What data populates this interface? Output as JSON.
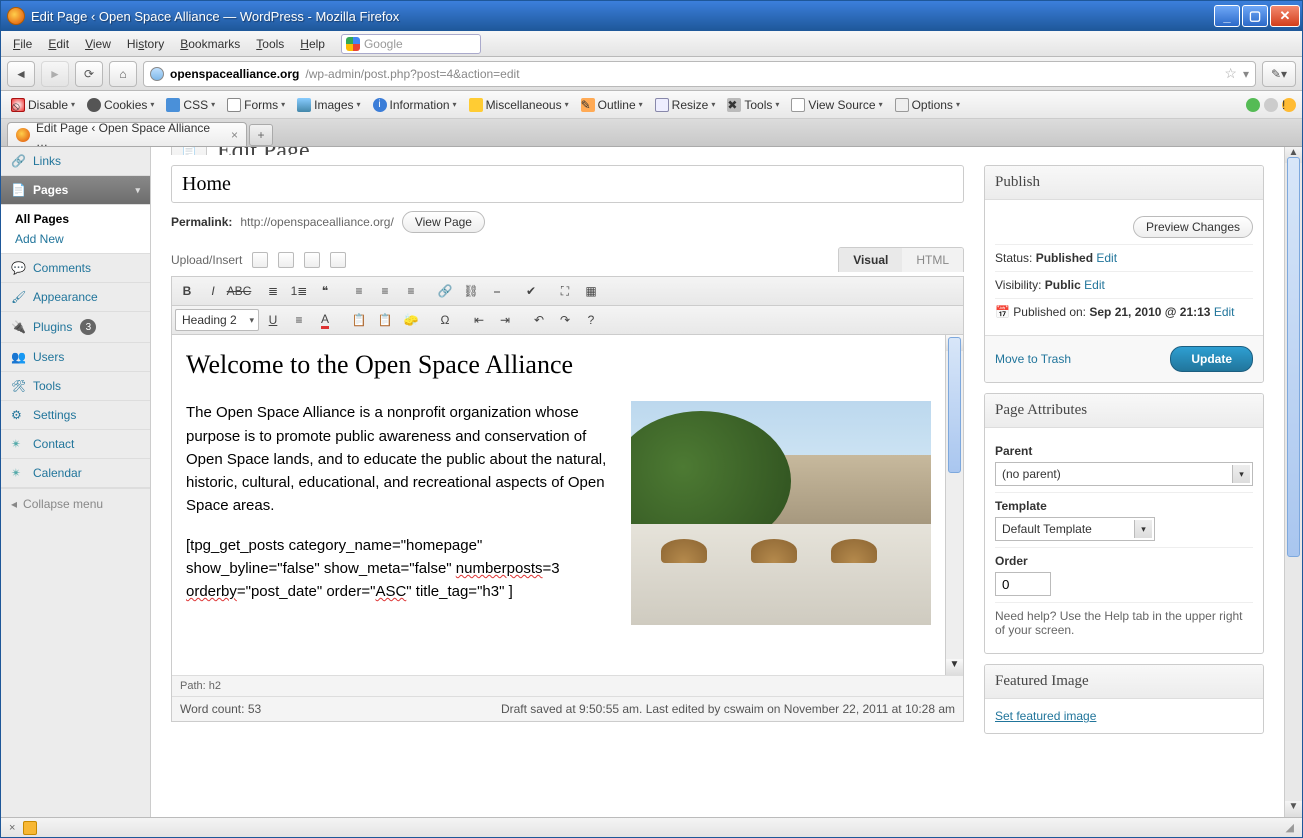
{
  "window": {
    "title": "Edit Page ‹ Open Space Alliance — WordPress - Mozilla Firefox"
  },
  "menu": {
    "file": "File",
    "edit": "Edit",
    "view": "View",
    "history": "History",
    "bookmarks": "Bookmarks",
    "tools": "Tools",
    "help": "Help",
    "search_placeholder": "Google"
  },
  "url": {
    "host": "openspacealliance.org",
    "path": "/wp-admin/post.php?post=4&action=edit"
  },
  "wdt": {
    "disable": "Disable",
    "cookies": "Cookies",
    "css": "CSS",
    "forms": "Forms",
    "images": "Images",
    "information": "Information",
    "miscellaneous": "Miscellaneous",
    "outline": "Outline",
    "resize": "Resize",
    "tools": "Tools",
    "viewsource": "View Source",
    "options": "Options"
  },
  "tab": {
    "title": "Edit Page ‹ Open Space Alliance …"
  },
  "sidebar": {
    "links": "Links",
    "pages": "Pages",
    "pages_sub_all": "All Pages",
    "pages_sub_add": "Add New",
    "comments": "Comments",
    "appearance": "Appearance",
    "plugins": "Plugins",
    "plugins_badge": "3",
    "users": "Users",
    "tools": "Tools",
    "settings": "Settings",
    "contact": "Contact",
    "calendar": "Calendar",
    "collapse": "Collapse menu"
  },
  "editpage": {
    "heading": "Edit Page"
  },
  "post": {
    "title": "Home",
    "permalink_label": "Permalink:",
    "permalink_url": "http://openspacealliance.org/",
    "view_page": "View Page",
    "upload_insert": "Upload/Insert",
    "tab_visual": "Visual",
    "tab_html": "HTML",
    "format_select": "Heading 2",
    "content_heading": "Welcome to the Open Space Alliance",
    "content_p1": "The Open Space Alliance is a nonprofit organization whose purpose is to promote public awareness and conservation of Open Space lands, and to educate the public about the natural, historic, cultural, educational, and recreational aspects of Open Space areas.",
    "shortcode_line1": "[tpg_get_posts category_name=\"homepage\" show_byline=\"false\" show_meta=\"false\" ",
    "sc_numberposts": "numberposts",
    "sc_eq3": "=3 ",
    "sc_orderby": "orderby",
    "sc_eqpd": "=\"post_date\" order=\"",
    "sc_asc": "ASC",
    "sc_tail": "\"  title_tag=\"h3\" ]",
    "path": "Path: h2",
    "wordcount_label": "Word count: ",
    "wordcount": "53",
    "autosave": "Draft saved at 9:50:55 am. Last edited by cswaim on November 22, 2011 at 10:28 am"
  },
  "publish": {
    "title": "Publish",
    "preview": "Preview Changes",
    "status_label": "Status: ",
    "status_value": "Published",
    "visibility_label": "Visibility: ",
    "visibility_value": "Public",
    "publishedon_label": "Published on: ",
    "publishedon_value": "Sep 21, 2010 @ 21:13",
    "edit": "Edit",
    "trash": "Move to Trash",
    "update": "Update"
  },
  "attributes": {
    "title": "Page Attributes",
    "parent_label": "Parent",
    "parent_value": "(no parent)",
    "template_label": "Template",
    "template_value": "Default Template",
    "order_label": "Order",
    "order_value": "0",
    "help": "Need help? Use the Help tab in the upper right of your screen."
  },
  "featured": {
    "title": "Featured Image",
    "link": "Set featured image"
  }
}
